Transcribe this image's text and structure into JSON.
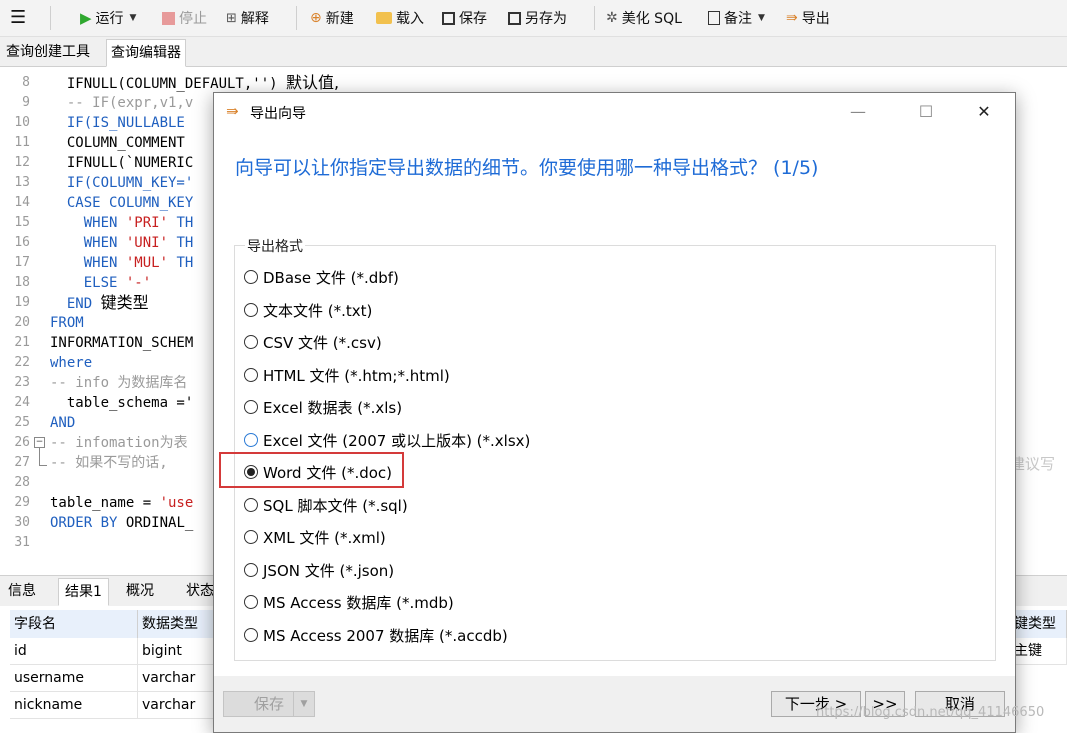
{
  "toolbar": {
    "run": "运行",
    "stop": "停止",
    "explain": "解释",
    "new": "新建",
    "load": "载入",
    "save": "保存",
    "save_as": "另存为",
    "beautify": "美化 SQL",
    "note": "备注",
    "export": "导出"
  },
  "tabs": [
    "查询创建工具",
    "查询编辑器"
  ],
  "editor": {
    "lines": [
      "8",
      "9",
      "10",
      "11",
      "12",
      "13",
      "14",
      "15",
      "16",
      "17",
      "18",
      "19",
      "20",
      "21",
      "22",
      "23",
      "24",
      "25",
      "26",
      "27",
      "28",
      "29",
      "30",
      "31"
    ],
    "code": {
      "l8a": "  IFNULL(COLUMN_DEFAULT,'') ",
      "l8b": "默认值,",
      "l9": "  -- IF(expr,v1,v",
      "l10": "  IF(IS_NULLABLE",
      "l11": "  COLUMN_COMMENT",
      "l12": "  IFNULL(`NUMERIC",
      "l13": "  IF(COLUMN_KEY='",
      "l14": "  CASE COLUMN_KEY",
      "l15a": "    WHEN ",
      "l15b": "'PRI'",
      "l15c": " TH",
      "l16a": "    WHEN ",
      "l16b": "'UNI'",
      "l16c": " TH",
      "l17a": "    WHEN ",
      "l17b": "'MUL'",
      "l17c": " TH",
      "l18a": "    ELSE ",
      "l18b": "'-'",
      "l19a": "  END ",
      "l19b": "键类型",
      "l20": "FROM",
      "l21": "INFORMATION_SCHEM",
      "l22": "where",
      "l23": "-- info 为数据库名",
      "l24": "  table_schema ='",
      "l25": "AND",
      "l26": "-- infomation为表",
      "l27": "-- 如果不写的话,",
      "l29a": "table_name = ",
      "l29b": "'use",
      "l30a": "ORDER BY",
      "l30b": " ORDINAL_",
      "ghost": "建议写"
    }
  },
  "bottom_tabs": [
    "信息",
    "结果1",
    "概况",
    "状态"
  ],
  "grid": {
    "headers": [
      "字段名",
      "数据类型",
      "键类型"
    ],
    "rows": [
      [
        "id",
        "bigint",
        "主键"
      ],
      [
        "username",
        "varchar",
        ""
      ],
      [
        "nickname",
        "varchar",
        ""
      ]
    ]
  },
  "dialog": {
    "title": "导出向导",
    "heading": "向导可以让你指定导出数据的细节。你要使用哪一种导出格式？ (1/5)",
    "group_label": "导出格式",
    "selected": "Word 文件 (*.doc)",
    "options": [
      "DBase 文件 (*.dbf)",
      "文本文件 (*.txt)",
      "CSV 文件 (*.csv)",
      "HTML 文件 (*.htm;*.html)",
      "Excel 数据表 (*.xls)",
      "Excel 文件 (2007 或以上版本) (*.xlsx)",
      "Word 文件 (*.doc)",
      "SQL 脚本文件 (*.sql)",
      "XML 文件 (*.xml)",
      "JSON 文件 (*.json)",
      "MS Access 数据库 (*.mdb)",
      "MS Access 2007 数据库 (*.accdb)"
    ],
    "buttons": {
      "save": "保存",
      "next": "下一步 >",
      "skip": ">>",
      "cancel": "取消"
    }
  },
  "watermark": "https://blog.csdn.net/qq_41146650"
}
